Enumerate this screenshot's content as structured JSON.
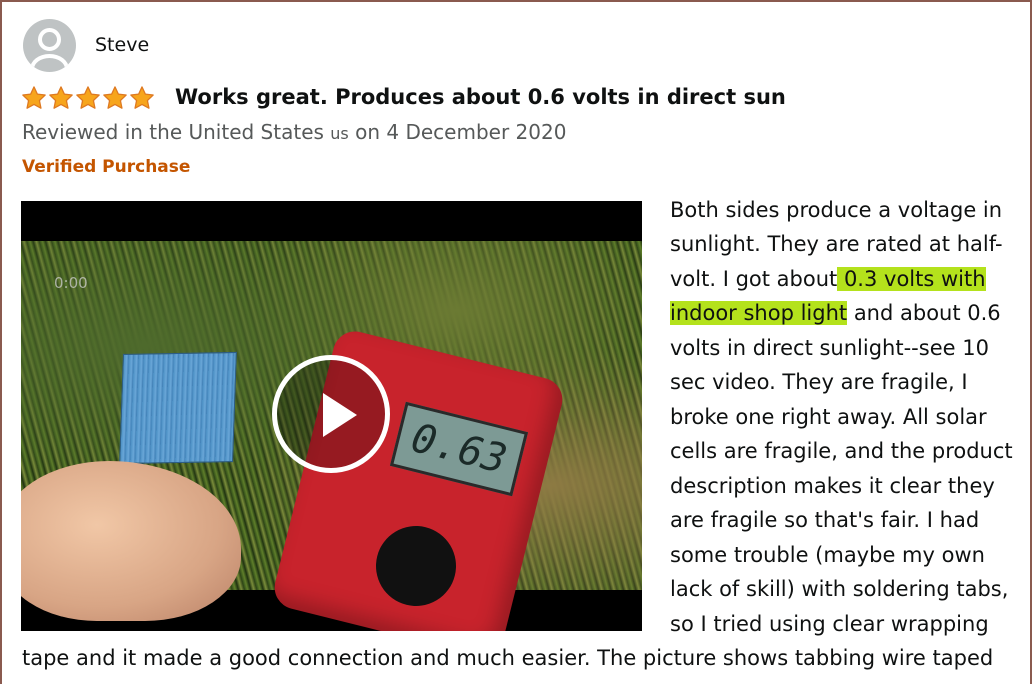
{
  "reviewer": {
    "name": "Steve",
    "avatar_icon": "user-silhouette-icon"
  },
  "rating": {
    "stars": 5,
    "max": 5,
    "star_color": "#f7a51c"
  },
  "review": {
    "title": "Works great. Produces about 0.6 volts in direct sun",
    "meta_prefix": "Reviewed in the United States",
    "meta_flag": "us",
    "meta_suffix": "on 4 December 2020",
    "verified_label": "Verified Purchase",
    "video_timecode": "0:00",
    "video_lcd_reading": "0.63",
    "play_icon": "play-icon",
    "body_lines": [
      " Both sides produce a voltage in",
      "sunlight. They are rated at half-",
      "volt. I got about",
      "0.3 volts with",
      "indoor shop light",
      " and about 0.6",
      "volts in direct sunlight--see 10",
      "sec video. They are fragile, I",
      "broke one right away. All solar",
      "cells are fragile, and the product",
      "description makes it clear they",
      "are fragile so that's fair. I had",
      "some trouble (maybe my own",
      "lack of skill) with soldering tabs,",
      "so I tried using clear wrapping",
      "tape and it made a good connection and much easier. The picture shows tabbing wire taped"
    ]
  },
  "colors": {
    "highlight": "#b4e21c",
    "verified": "#c45500",
    "meta_text": "#565959"
  }
}
